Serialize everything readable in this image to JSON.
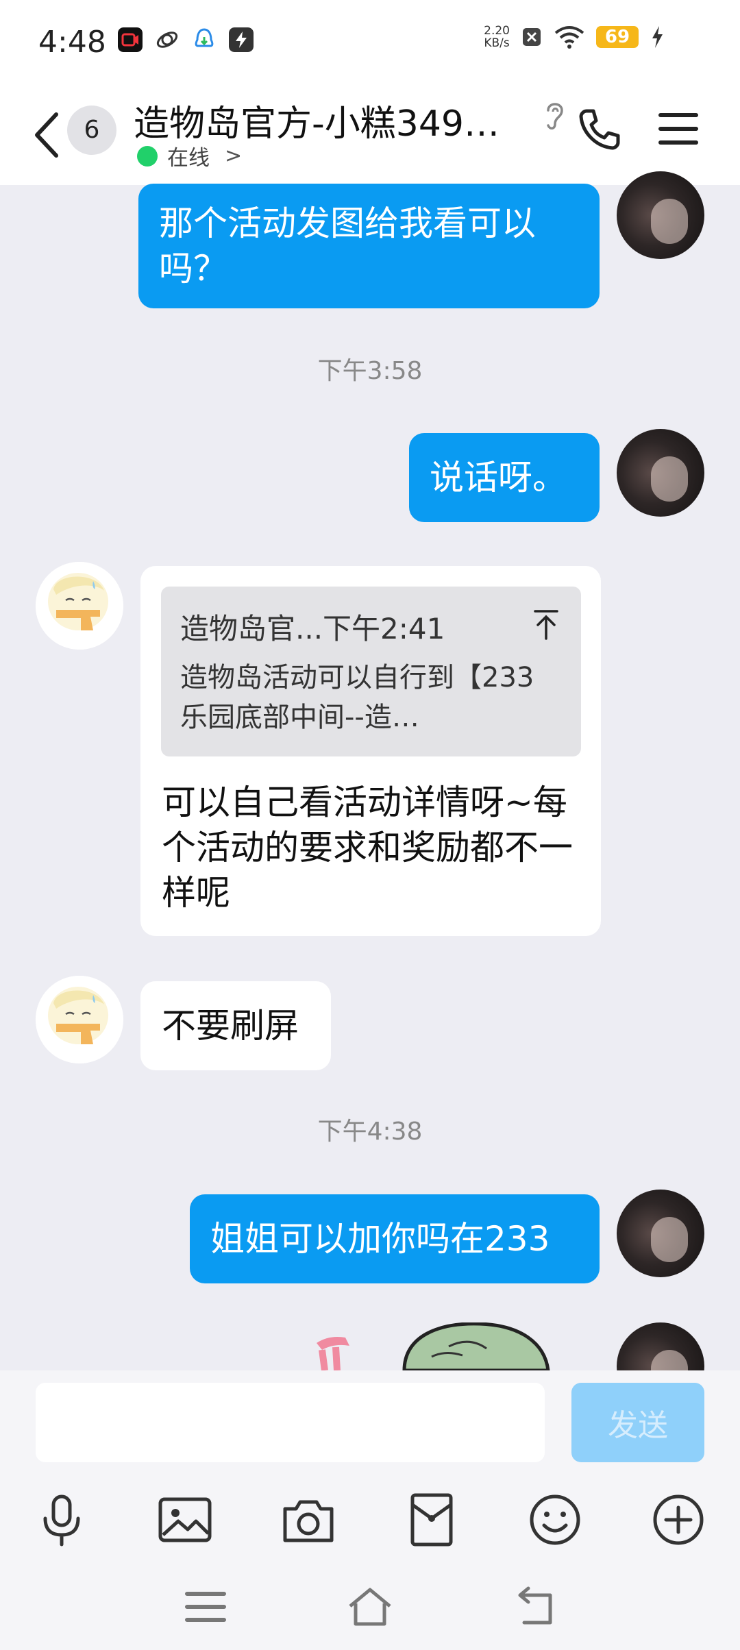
{
  "status_bar": {
    "time": "4:48",
    "net_speed_value": "2.20",
    "net_speed_unit": "KB/s",
    "battery": "69"
  },
  "header": {
    "unread_count": "6",
    "title": "造物岛官方-小糕349…",
    "status": "在线"
  },
  "messages": {
    "m1": "那个活动发图给我看可以吗？",
    "ts1": "下午3:58",
    "m2": "说话呀。",
    "quote_head": "造物岛官...下午2:41",
    "quote_body": "造物岛活动可以自行到【233乐园底部中间--造…",
    "m3": "可以自己看活动详情呀~每个活动的要求和奖励都不一样呢",
    "m4": "不要刷屏",
    "ts2": "下午4:38",
    "m5": "姐姐可以加你吗在233"
  },
  "input": {
    "value": "",
    "send_label": "发送"
  },
  "toolbar": {
    "icons": [
      "microphone-icon",
      "image-icon",
      "camera-icon",
      "red-packet-icon",
      "emoji-icon",
      "plus-icon"
    ]
  },
  "colors": {
    "my_bubble": "#0a9bf2",
    "background": "#ededf3",
    "online": "#21d06a",
    "send_disabled": "#8fd0fa",
    "battery": "#f6b719"
  }
}
